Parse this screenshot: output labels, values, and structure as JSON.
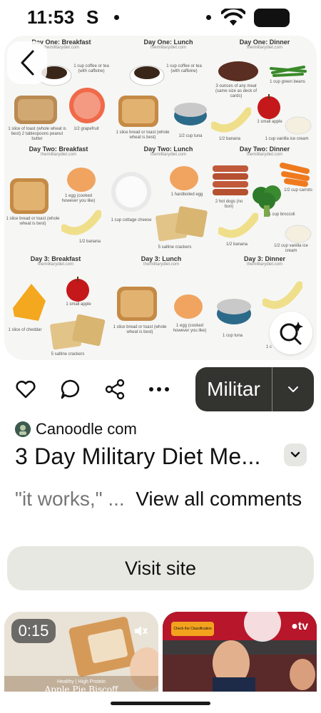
{
  "status_bar": {
    "time": "11:53",
    "indicator": "S"
  },
  "pin": {
    "sections": [
      {
        "title": "Day One: Breakfast",
        "site": "themilitarydiet.com"
      },
      {
        "title": "Day One: Lunch",
        "site": "themilitarydiet.com"
      },
      {
        "title": "Day One: Dinner",
        "site": "themilitarydiet.com"
      },
      {
        "title": "Day Two: Breakfast",
        "site": "themilitarydiet.com"
      },
      {
        "title": "Day Two: Lunch",
        "site": "themilitarydiet.com"
      },
      {
        "title": "Day Two: Dinner",
        "site": "themilitarydiet.com"
      },
      {
        "title": "Day 3: Breakfast",
        "site": "themilitarydiet.com"
      },
      {
        "title": "Day 3: Lunch",
        "site": "themilitarydiet.com"
      },
      {
        "title": "Day 3: Dinner",
        "site": "themilitarydiet.com"
      }
    ],
    "captions": [
      "1 cup coffee or tea (with caffeine)",
      "1 cup coffee or tea (with caffeine)",
      "3 ounces of any meat (same size as deck of cards)",
      "1 cup green beans",
      "1 slice of toast (whole wheat is best) 2 tablespoons peanut butter",
      "1/2 grapefruit",
      "1 slice bread or toast (whole wheat is best)",
      "1/2 cup tuna",
      "1/2 banana",
      "1 small apple",
      "1 cup vanilla ice cream",
      "1 egg (cooked however you like)",
      "1 slice bread or toast (whole wheat is best)",
      "1 cup cottage cheese",
      "1/2 banana",
      "5 saltine crackers",
      "1 hardboiled egg",
      "2 hot dogs (no bun)",
      "1/2 banana",
      "1/2 cup carrots",
      "1 cup broccoli",
      "1/2 cup vanilla ice cream",
      "1 slice of cheddar",
      "1 small apple",
      "5 saltine crackers",
      "1 slice bread or toast (whole wheat is best)",
      "1 egg (cooked however you like)",
      "1 cup tuna",
      "1 c"
    ]
  },
  "actions": {
    "save_label": "Militar"
  },
  "source": {
    "name": "Canoodle com"
  },
  "title": "3 Day Military Diet Me...",
  "comment": {
    "quote": "\"it works,\" ...",
    "view_all": "View all comments"
  },
  "visit": {
    "label": "Visit site"
  },
  "related": {
    "video_duration": "0:15",
    "thumb1_text": "Healthy | High Protein",
    "thumb1_title": "Apple Pie Biscoff",
    "thumb2_badge": "Check the Classification",
    "thumb2_brand": "tv"
  }
}
